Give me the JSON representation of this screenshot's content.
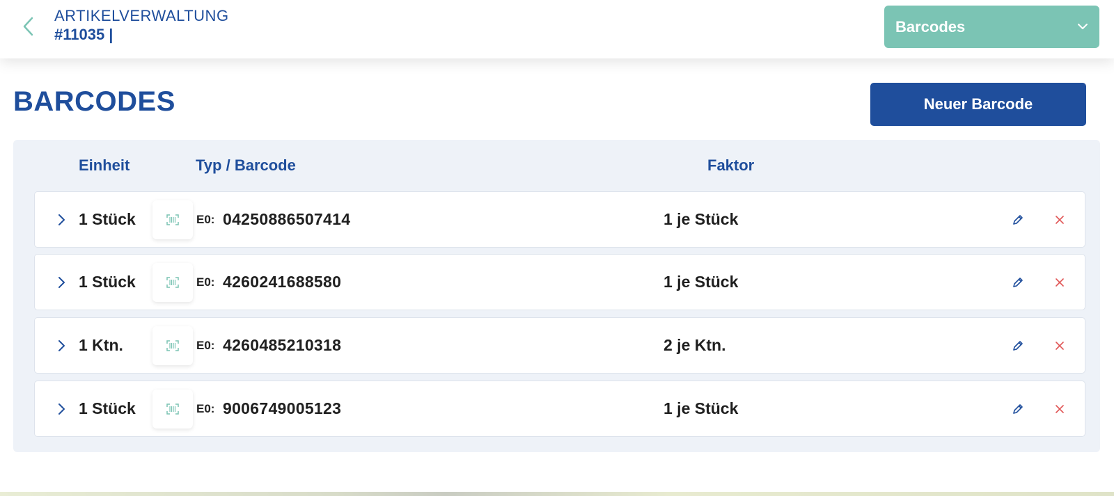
{
  "header": {
    "section": "ARTIKELVERWALTUNG",
    "article_id": "#11035 |",
    "view_select": {
      "selected": "Barcodes"
    }
  },
  "page": {
    "title": "BARCODES",
    "new_button_label": "Neuer Barcode"
  },
  "table": {
    "columns": {
      "unit": "Einheit",
      "type_barcode": "Typ / Barcode",
      "factor": "Faktor"
    },
    "rows": [
      {
        "unit": "1 Stück",
        "type": "E0:",
        "barcode": "04250886507414",
        "factor": "1 je Stück"
      },
      {
        "unit": "1 Stück",
        "type": "E0:",
        "barcode": "4260241688580",
        "factor": "1 je Stück"
      },
      {
        "unit": "1 Ktn.",
        "type": "E0:",
        "barcode": "4260485210318",
        "factor": "2 je Ktn."
      },
      {
        "unit": "1 Stück",
        "type": "E0:",
        "barcode": "9006749005123",
        "factor": "1 je Stück"
      }
    ]
  },
  "colors": {
    "brand_blue": "#1f4e9c",
    "accent_teal": "#7bc4b4",
    "delete_red": "#e05555",
    "panel_bg": "#eef2f8"
  },
  "icons": {
    "back": "chevron-left-icon",
    "dropdown": "chevron-down-icon",
    "expand": "chevron-right-icon",
    "barcode": "barcode-scan-icon",
    "edit": "pencil-icon",
    "delete": "close-icon"
  }
}
